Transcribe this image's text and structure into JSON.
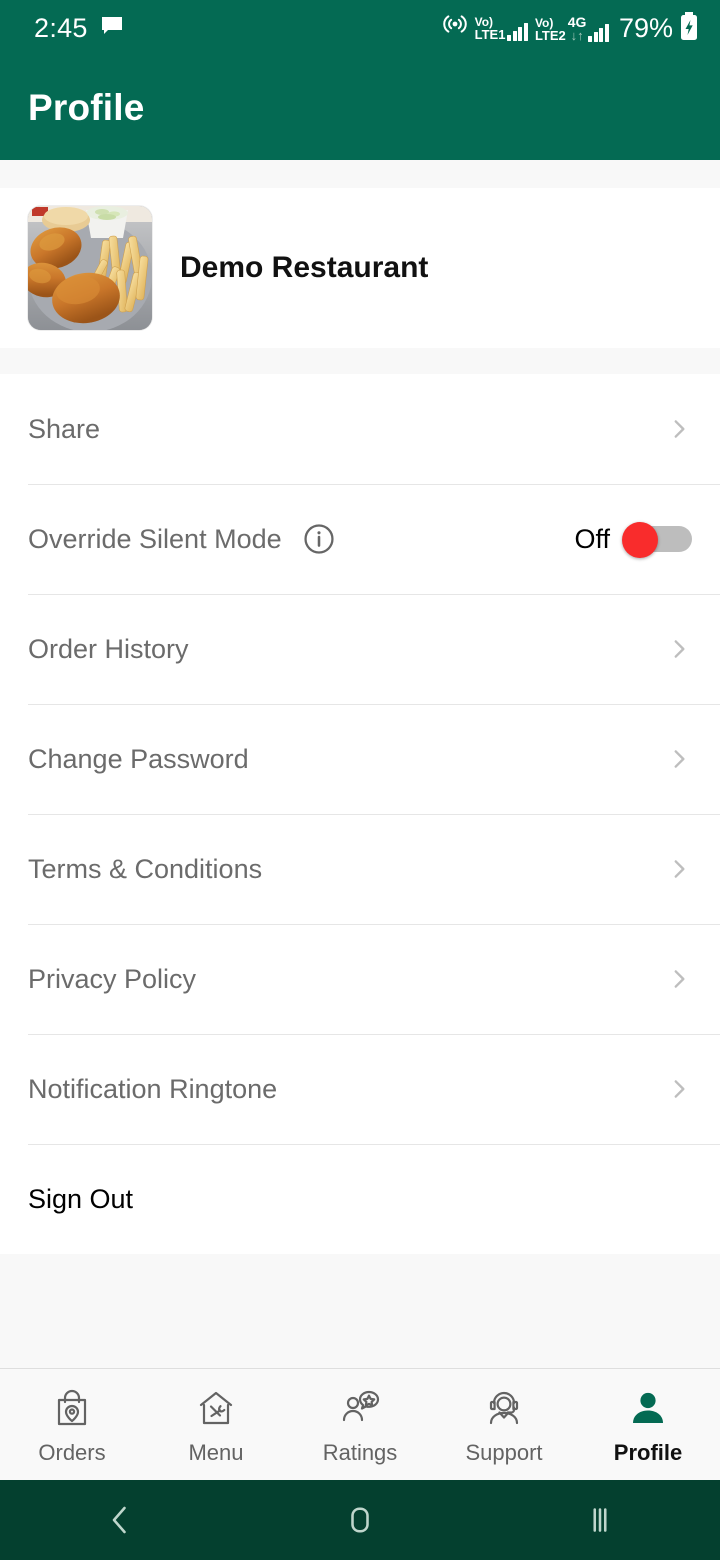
{
  "status_bar": {
    "time": "2:45",
    "message_icon": "message-icon",
    "hotspot_icon": "hotspot-icon",
    "sim1": {
      "volte": "Vo)",
      "network": "LTE1"
    },
    "sim2": {
      "volte": "Vo)",
      "network": "LTE2"
    },
    "data_type": "4G",
    "battery_percent": "79%",
    "battery_icon": "battery-charging-icon"
  },
  "app_bar": {
    "title": "Profile"
  },
  "profile": {
    "avatar_icon": "restaurant-photo",
    "restaurant_name": "Demo Restaurant"
  },
  "menu": {
    "items": [
      {
        "label": "Share",
        "type": "link",
        "accessory": "chevron-right-icon"
      },
      {
        "label": "Override Silent Mode",
        "type": "toggle",
        "accessory": "toggle-switch",
        "info_icon": "info-icon",
        "toggle_state": "Off",
        "toggle_on": false
      },
      {
        "label": "Order History",
        "type": "link",
        "accessory": "chevron-right-icon"
      },
      {
        "label": "Change Password",
        "type": "link",
        "accessory": "chevron-right-icon"
      },
      {
        "label": "Terms & Conditions",
        "type": "link",
        "accessory": "chevron-right-icon"
      },
      {
        "label": "Privacy Policy",
        "type": "link",
        "accessory": "chevron-right-icon"
      },
      {
        "label": "Notification Ringtone",
        "type": "link",
        "accessory": "chevron-right-icon"
      },
      {
        "label": "Sign Out",
        "type": "action",
        "accessory": "none"
      }
    ]
  },
  "bottom_nav": {
    "items": [
      {
        "label": "Orders",
        "icon": "shopping-bag-pin-icon",
        "active": false
      },
      {
        "label": "Menu",
        "icon": "house-cutlery-icon",
        "active": false
      },
      {
        "label": "Ratings",
        "icon": "person-star-bubble-icon",
        "active": false
      },
      {
        "label": "Support",
        "icon": "headset-person-icon",
        "active": false
      },
      {
        "label": "Profile",
        "icon": "person-filled-icon",
        "active": true
      }
    ]
  },
  "system_nav": {
    "back": "back-icon",
    "home": "home-icon",
    "recents": "recents-icon"
  },
  "colors": {
    "brand_green": "#046A53",
    "system_nav_green": "#04402F",
    "toggle_off_thumb": "#F92C2C",
    "toggle_track": "#BDBDBD",
    "band_gray": "#F8F8F8",
    "label_gray": "#6B6B6B"
  }
}
